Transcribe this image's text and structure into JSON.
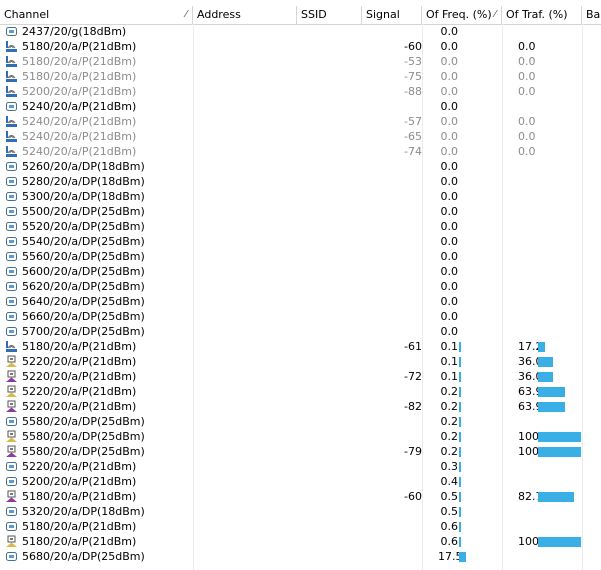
{
  "columns": {
    "channel": "Channel",
    "address": "Address",
    "ssid": "SSID",
    "signal": "Signal",
    "of_freq": "Of Freq. (%)",
    "of_traf": "Of Traf. (%)",
    "band": "Ban"
  },
  "colors": {
    "bar": "#3aafe6",
    "dim_text": "#8c8c8c",
    "grid": "#d5d5d5"
  },
  "rows": [
    {
      "icon": "radio-icon",
      "channel": "2437/20/g(18dBm)",
      "signal": "",
      "freq": "0.0",
      "freq_bar": 0,
      "traf": "",
      "traf_bar": 0,
      "dim": false
    },
    {
      "icon": "signal-icon",
      "channel": "5180/20/a/P(21dBm)",
      "signal": "-60",
      "freq": "0.0",
      "freq_bar": 0,
      "traf": "0.0",
      "traf_bar": 0,
      "dim": false
    },
    {
      "icon": "signal-icon",
      "channel": "5180/20/a/P(21dBm)",
      "signal": "-53",
      "freq": "0.0",
      "freq_bar": 0,
      "traf": "0.0",
      "traf_bar": 0,
      "dim": true
    },
    {
      "icon": "signal-icon",
      "channel": "5180/20/a/P(21dBm)",
      "signal": "-75",
      "freq": "0.0",
      "freq_bar": 0,
      "traf": "0.0",
      "traf_bar": 0,
      "dim": true
    },
    {
      "icon": "signal-icon",
      "channel": "5200/20/a/P(21dBm)",
      "signal": "-88",
      "freq": "0.0",
      "freq_bar": 0,
      "traf": "0.0",
      "traf_bar": 0,
      "dim": true
    },
    {
      "icon": "radio-icon",
      "channel": "5240/20/a/P(21dBm)",
      "signal": "",
      "freq": "0.0",
      "freq_bar": 0,
      "traf": "",
      "traf_bar": 0,
      "dim": false
    },
    {
      "icon": "signal-icon",
      "channel": "5240/20/a/P(21dBm)",
      "signal": "-57",
      "freq": "0.0",
      "freq_bar": 0,
      "traf": "0.0",
      "traf_bar": 0,
      "dim": true
    },
    {
      "icon": "signal-icon",
      "channel": "5240/20/a/P(21dBm)",
      "signal": "-65",
      "freq": "0.0",
      "freq_bar": 0,
      "traf": "0.0",
      "traf_bar": 0,
      "dim": true
    },
    {
      "icon": "signal-icon",
      "channel": "5240/20/a/P(21dBm)",
      "signal": "-74",
      "freq": "0.0",
      "freq_bar": 0,
      "traf": "0.0",
      "traf_bar": 0,
      "dim": true
    },
    {
      "icon": "radio-icon",
      "channel": "5260/20/a/DP(18dBm)",
      "signal": "",
      "freq": "0.0",
      "freq_bar": 0,
      "traf": "",
      "traf_bar": 0,
      "dim": false
    },
    {
      "icon": "radio-icon",
      "channel": "5280/20/a/DP(18dBm)",
      "signal": "",
      "freq": "0.0",
      "freq_bar": 0,
      "traf": "",
      "traf_bar": 0,
      "dim": false
    },
    {
      "icon": "radio-icon",
      "channel": "5300/20/a/DP(18dBm)",
      "signal": "",
      "freq": "0.0",
      "freq_bar": 0,
      "traf": "",
      "traf_bar": 0,
      "dim": false
    },
    {
      "icon": "radio-icon",
      "channel": "5500/20/a/DP(25dBm)",
      "signal": "",
      "freq": "0.0",
      "freq_bar": 0,
      "traf": "",
      "traf_bar": 0,
      "dim": false
    },
    {
      "icon": "radio-icon",
      "channel": "5520/20/a/DP(25dBm)",
      "signal": "",
      "freq": "0.0",
      "freq_bar": 0,
      "traf": "",
      "traf_bar": 0,
      "dim": false
    },
    {
      "icon": "radio-icon",
      "channel": "5540/20/a/DP(25dBm)",
      "signal": "",
      "freq": "0.0",
      "freq_bar": 0,
      "traf": "",
      "traf_bar": 0,
      "dim": false
    },
    {
      "icon": "radio-icon",
      "channel": "5560/20/a/DP(25dBm)",
      "signal": "",
      "freq": "0.0",
      "freq_bar": 0,
      "traf": "",
      "traf_bar": 0,
      "dim": false
    },
    {
      "icon": "radio-icon",
      "channel": "5600/20/a/DP(25dBm)",
      "signal": "",
      "freq": "0.0",
      "freq_bar": 0,
      "traf": "",
      "traf_bar": 0,
      "dim": false
    },
    {
      "icon": "radio-icon",
      "channel": "5620/20/a/DP(25dBm)",
      "signal": "",
      "freq": "0.0",
      "freq_bar": 0,
      "traf": "",
      "traf_bar": 0,
      "dim": false
    },
    {
      "icon": "radio-icon",
      "channel": "5640/20/a/DP(25dBm)",
      "signal": "",
      "freq": "0.0",
      "freq_bar": 0,
      "traf": "",
      "traf_bar": 0,
      "dim": false
    },
    {
      "icon": "radio-icon",
      "channel": "5660/20/a/DP(25dBm)",
      "signal": "",
      "freq": "0.0",
      "freq_bar": 0,
      "traf": "",
      "traf_bar": 0,
      "dim": false
    },
    {
      "icon": "radio-icon",
      "channel": "5700/20/a/DP(25dBm)",
      "signal": "",
      "freq": "0.0",
      "freq_bar": 0,
      "traf": "",
      "traf_bar": 0,
      "dim": false
    },
    {
      "icon": "signal-icon",
      "channel": "5180/20/a/P(21dBm)",
      "signal": "-61",
      "freq": "0.1",
      "freq_bar": 0.1,
      "traf": "17.2",
      "traf_bar": 17.2,
      "dim": false
    },
    {
      "icon": "device-icon",
      "channel": "5220/20/a/P(21dBm)",
      "signal": "",
      "freq": "0.1",
      "freq_bar": 0.1,
      "traf": "36.0",
      "traf_bar": 36.0,
      "dim": false
    },
    {
      "icon": "device-purple-icon",
      "channel": "5220/20/a/P(21dBm)",
      "signal": "-72",
      "freq": "0.1",
      "freq_bar": 0.1,
      "traf": "36.0",
      "traf_bar": 36.0,
      "dim": false
    },
    {
      "icon": "device-icon",
      "channel": "5220/20/a/P(21dBm)",
      "signal": "",
      "freq": "0.2",
      "freq_bar": 0.2,
      "traf": "63.9",
      "traf_bar": 63.9,
      "dim": false
    },
    {
      "icon": "device-purple-icon",
      "channel": "5220/20/a/P(21dBm)",
      "signal": "-82",
      "freq": "0.2",
      "freq_bar": 0.2,
      "traf": "63.9",
      "traf_bar": 63.9,
      "dim": false
    },
    {
      "icon": "radio-icon",
      "channel": "5580/20/a/DP(25dBm)",
      "signal": "",
      "freq": "0.2",
      "freq_bar": 0.2,
      "traf": "",
      "traf_bar": 0,
      "dim": false
    },
    {
      "icon": "device-icon",
      "channel": "5580/20/a/DP(25dBm)",
      "signal": "",
      "freq": "0.2",
      "freq_bar": 0.2,
      "traf": "100.0",
      "traf_bar": 100.0,
      "dim": false
    },
    {
      "icon": "device-purple-icon",
      "channel": "5580/20/a/DP(25dBm)",
      "signal": "-79",
      "freq": "0.2",
      "freq_bar": 0.2,
      "traf": "100.0",
      "traf_bar": 100.0,
      "dim": false
    },
    {
      "icon": "radio-icon",
      "channel": "5220/20/a/P(21dBm)",
      "signal": "",
      "freq": "0.3",
      "freq_bar": 0.3,
      "traf": "",
      "traf_bar": 0,
      "dim": false
    },
    {
      "icon": "radio-icon",
      "channel": "5200/20/a/P(21dBm)",
      "signal": "",
      "freq": "0.4",
      "freq_bar": 0.4,
      "traf": "",
      "traf_bar": 0,
      "dim": false
    },
    {
      "icon": "device-purple-icon",
      "channel": "5180/20/a/P(21dBm)",
      "signal": "-60",
      "freq": "0.5",
      "freq_bar": 0.5,
      "traf": "82.7",
      "traf_bar": 82.7,
      "dim": false
    },
    {
      "icon": "radio-icon",
      "channel": "5320/20/a/DP(18dBm)",
      "signal": "",
      "freq": "0.5",
      "freq_bar": 0.5,
      "traf": "",
      "traf_bar": 0,
      "dim": false
    },
    {
      "icon": "radio-icon",
      "channel": "5180/20/a/P(21dBm)",
      "signal": "",
      "freq": "0.6",
      "freq_bar": 0.6,
      "traf": "",
      "traf_bar": 0,
      "dim": false
    },
    {
      "icon": "device-icon",
      "channel": "5180/20/a/P(21dBm)",
      "signal": "",
      "freq": "0.6",
      "freq_bar": 0.6,
      "traf": "100.0",
      "traf_bar": 100.0,
      "dim": false
    },
    {
      "icon": "radio-icon",
      "channel": "5680/20/a/DP(25dBm)",
      "signal": "",
      "freq": "17.5",
      "freq_bar": 17.5,
      "traf": "",
      "traf_bar": 0,
      "dim": false
    }
  ]
}
